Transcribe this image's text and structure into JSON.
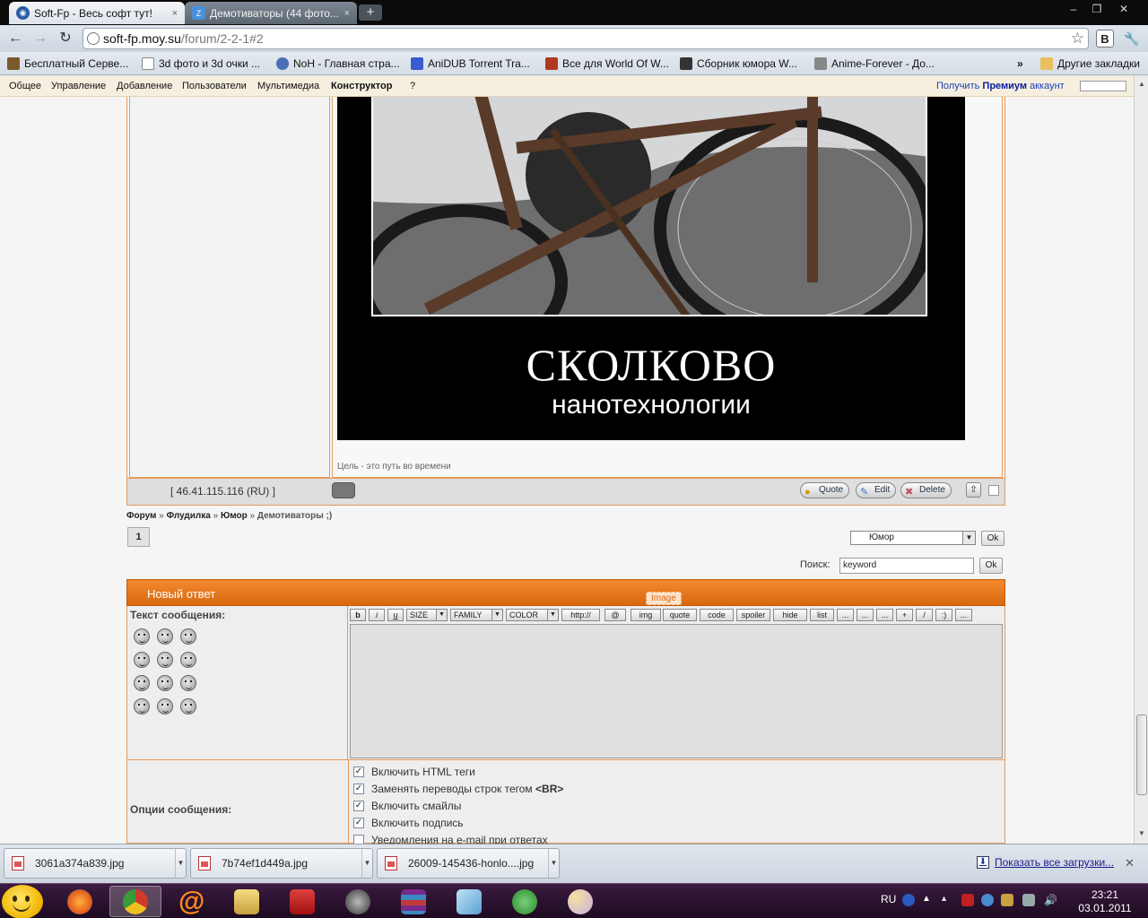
{
  "browser": {
    "tabs": [
      {
        "title": "Soft-Fp - Весь софт тут!",
        "active": true,
        "close": "×"
      },
      {
        "title": "Демотиваторы (44 фото...",
        "active": false,
        "close": "×"
      }
    ],
    "new_tab": "+",
    "window_controls": {
      "minimize": "–",
      "restore": "❐",
      "close": "✕"
    },
    "nav": {
      "back": "←",
      "forward": "→",
      "reload": "↻"
    },
    "address": {
      "host": "soft-fp.moy.su",
      "path": "/forum/2-2-1#2"
    },
    "star": "☆",
    "extensions": {
      "vk": "В",
      "wrench": "🔧"
    },
    "bookmarks": [
      {
        "label": "Бесплатный Серве...",
        "color": "#7a5a2a"
      },
      {
        "label": "3d фото и 3d очки ...",
        "color": "#ffffff"
      },
      {
        "label": "NoH - Главная стра...",
        "color": "#4a6fb8"
      },
      {
        "label": "AniDUB Torrent Tra...",
        "color": "#3a5ad0"
      },
      {
        "label": "Все для World Of W...",
        "color": "#b03a20"
      },
      {
        "label": "Сборник юмора W...",
        "color": "#333333"
      },
      {
        "label": "Anime-Forever - До...",
        "color": "#888888"
      }
    ],
    "bookmarks_more": "»",
    "other_bookmarks": "Другие закладки"
  },
  "ucoz_bar": {
    "items": [
      "Общее",
      "Управление",
      "Добавление",
      "Пользователи",
      "Мультимедиа",
      "Конструктор",
      "?"
    ],
    "premium_prefix": "Получить",
    "premium_bold": "Премиум",
    "premium_suffix": "аккаунт"
  },
  "post": {
    "demotivator_title": "СКОЛКОВО",
    "demotivator_subtitle": "нанотехнологии",
    "signature": "Цель - это путь во времени",
    "ip": "[ 46.41.115.116 (RU) ]",
    "buttons": {
      "quote": "Quote",
      "edit": "Edit",
      "delete": "Delete"
    },
    "up_arrow": "⇧"
  },
  "breadcrumb": {
    "items": [
      "Форум",
      "Флудилка",
      "Юмор"
    ],
    "sep": "»",
    "current": "Демотиваторы ;)"
  },
  "pager": {
    "current": "1"
  },
  "forum_jump": {
    "selected": "Юмор",
    "ok": "Ok",
    "arrow": "▼"
  },
  "search": {
    "label": "Поиск:",
    "value": "keyword",
    "ok": "Ok"
  },
  "reply": {
    "title": "Новый ответ",
    "tooltip": "Image",
    "message_label": "Текст сообщения:",
    "editor_buttons": [
      "b",
      "i",
      "u",
      "http://",
      "@",
      "img",
      "quote",
      "code",
      "spoiler",
      "hide",
      "list",
      "...",
      "...",
      "...",
      "+",
      "/",
      ":)",
      "..."
    ],
    "size_select": "SIZE",
    "family_select": "FAMILY",
    "color_select": "COLOR",
    "options_label": "Опции сообщения:",
    "options": [
      {
        "label": "Включить HTML теги",
        "checked": true
      },
      {
        "label": "Заменять переводы строк тегом",
        "bold": "<BR>",
        "checked": true
      },
      {
        "label": "Включить смайлы",
        "checked": true
      },
      {
        "label": "Включить подпись",
        "checked": true
      },
      {
        "label": "Уведомления на e-mail при ответах",
        "checked": false
      }
    ]
  },
  "downloads": {
    "files": [
      "3061a374a839.jpg",
      "7b74ef1d449a.jpg",
      "26009-145436-honlo....jpg"
    ],
    "show_all": "Показать все загрузки...",
    "close": "✕"
  },
  "taskbar": {
    "apps": [
      {
        "name": "firefox",
        "color": "#e8641c"
      },
      {
        "name": "chrome",
        "color": "#3c8a3c",
        "active": true
      },
      {
        "name": "mail-agent",
        "color": "#ff8c1a"
      },
      {
        "name": "explorer",
        "color": "#e0c060"
      },
      {
        "name": "acrobat",
        "color": "#c02020"
      },
      {
        "name": "steam",
        "color": "#3a3a3a"
      },
      {
        "name": "winrar",
        "color": "#7a2a8a"
      },
      {
        "name": "notepad",
        "color": "#6ab0e0"
      },
      {
        "name": "utorrent",
        "color": "#3aa03a"
      },
      {
        "name": "paint",
        "color": "#d8d0e8"
      }
    ],
    "lang": "RU",
    "time": "23:21",
    "date": "03.01.2011"
  }
}
